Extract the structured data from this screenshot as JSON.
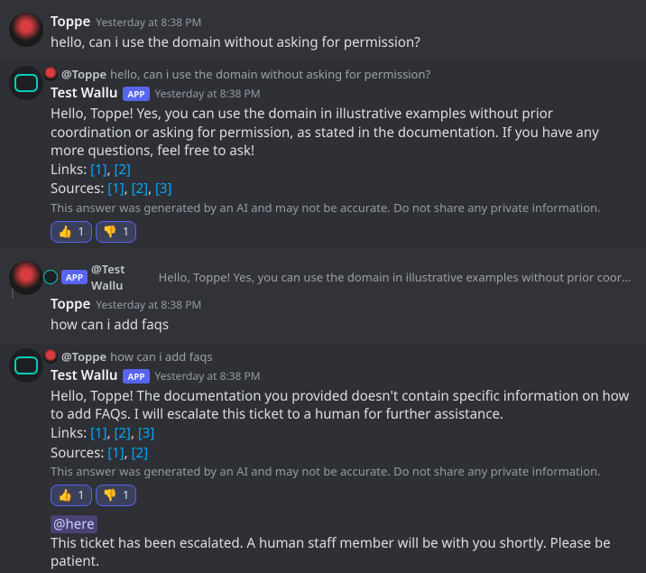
{
  "messages": [
    {
      "author": "Toppe",
      "timestamp": "Yesterday at 8:38 PM",
      "text": "hello, can i use the domain without asking for permission?"
    },
    {
      "reply": {
        "mention": "@Toppe",
        "text": "hello, can i use the domain without asking for permission?"
      },
      "author": "Test Wallu",
      "app_badge": "APP",
      "timestamp": "Yesterday at 8:38 PM",
      "body": "Hello, Toppe! Yes, you can use the domain in illustrative examples without prior coordination or asking for permission, as stated in the documentation. If you have any more questions, feel free to ask!",
      "links_label": "Links:",
      "links": [
        "[1]",
        "[2]"
      ],
      "sources_label": "Sources:",
      "sources": [
        "[1]",
        "[2]",
        "[3]"
      ],
      "disclaimer": "This answer was generated by an AI and may not be accurate. Do not share any private information.",
      "reactions": [
        {
          "emoji": "👍",
          "count": "1"
        },
        {
          "emoji": "👎",
          "count": "1"
        }
      ]
    },
    {
      "reply": {
        "app_badge": "APP",
        "mention": "@Test Wallu",
        "text": "Hello, Toppe! Yes, you can use the domain in illustrative examples without prior coordinatio…"
      },
      "author": "Toppe",
      "timestamp": "Yesterday at 8:38 PM",
      "text": "how can i add faqs"
    },
    {
      "reply": {
        "mention": "@Toppe",
        "text": "how can i add faqs"
      },
      "author": "Test Wallu",
      "app_badge": "APP",
      "timestamp": "Yesterday at 8:38 PM",
      "body": "Hello, Toppe! The documentation you provided doesn't contain specific information on how to add FAQs. I will escalate this ticket to a human for further assistance.",
      "links_label": "Links:",
      "links": [
        "[1]",
        "[2]",
        "[3]"
      ],
      "sources_label": "Sources:",
      "sources": [
        "[1]",
        "[2]"
      ],
      "disclaimer": "This answer was generated by an AI and may not be accurate. Do not share any private information.",
      "reactions": [
        {
          "emoji": "👍",
          "count": "1"
        },
        {
          "emoji": "👎",
          "count": "1"
        }
      ],
      "mention_here": "@here",
      "escalation": "This ticket has been escalated. A human staff member will be with you shortly. Please be patient."
    }
  ],
  "sep": ", "
}
